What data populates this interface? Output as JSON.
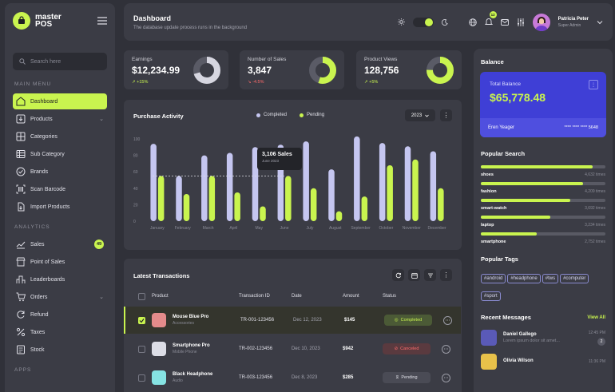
{
  "brand": {
    "line1": "master",
    "line2": "POS"
  },
  "sidebar": {
    "search_placeholder": "Search here",
    "section_main": "MAIN MENU",
    "section_analytics": "ANALYTICS",
    "section_apps": "APPS",
    "main_items": [
      {
        "label": "Dashboard",
        "icon": "home-icon",
        "active": true
      },
      {
        "label": "Products",
        "icon": "box-icon",
        "chevron": true
      },
      {
        "label": "Categories",
        "icon": "grid-icon"
      },
      {
        "label": "Sub Category",
        "icon": "table-icon"
      },
      {
        "label": "Brands",
        "icon": "check-circle-icon"
      },
      {
        "label": "Scan Barcode",
        "icon": "barcode-icon"
      },
      {
        "label": "Import Products",
        "icon": "import-icon"
      }
    ],
    "analytics_items": [
      {
        "label": "Sales",
        "icon": "trend-icon",
        "badge": "49"
      },
      {
        "label": "Point of Sales",
        "icon": "store-icon"
      },
      {
        "label": "Leaderboards",
        "icon": "leaderboard-icon"
      },
      {
        "label": "Orders",
        "icon": "cart-icon",
        "chevron": true
      },
      {
        "label": "Refund",
        "icon": "refund-icon"
      },
      {
        "label": "Taxes",
        "icon": "percent-icon"
      },
      {
        "label": "Stock",
        "icon": "stock-icon"
      }
    ]
  },
  "header": {
    "title": "Dashboard",
    "subtitle": "The database update process runs in the background",
    "notification_count": "12",
    "user_name": "Patricia Peter",
    "user_role": "Super Admin"
  },
  "stats": [
    {
      "label": "Earnings",
      "value": "$12,234.99",
      "delta": "+15%",
      "trend": "up",
      "donut_fill": 0.7
    },
    {
      "label": "Number of Sales",
      "value": "3,847",
      "delta": "-4.5%",
      "trend": "down",
      "donut_fill": 0.55
    },
    {
      "label": "Product Views",
      "value": "128,756",
      "delta": "+5%",
      "trend": "up",
      "donut_fill": 0.75
    }
  ],
  "purchase": {
    "title": "Purchase Activity",
    "legend_completed": "Completed",
    "legend_pending": "Pending",
    "year": "2023",
    "tooltip_value": "3,106 Sales",
    "tooltip_date": "June 2023"
  },
  "chart_data": {
    "type": "bar",
    "categories": [
      "January",
      "February",
      "March",
      "April",
      "May",
      "June",
      "July",
      "August",
      "September",
      "October",
      "November",
      "December"
    ],
    "ylim": [
      0,
      100
    ],
    "yticks": [
      0,
      20,
      40,
      60,
      80,
      100
    ],
    "series": [
      {
        "name": "Completed",
        "color": "#c5c6f0",
        "values": [
          94,
          55,
          80,
          83,
          90,
          93,
          97,
          63,
          103,
          95,
          91,
          85
        ]
      },
      {
        "name": "Pending",
        "color": "#c9f44f",
        "values": [
          55,
          33,
          55,
          35,
          18,
          55,
          40,
          12,
          30,
          68,
          75,
          40
        ]
      }
    ]
  },
  "transactions": {
    "title": "Latest Transactions",
    "columns": [
      "Product",
      "Transaction ID",
      "Date",
      "Amount",
      "Status"
    ],
    "rows": [
      {
        "name": "Mouse Blue Pro",
        "category": "Accessories",
        "id": "TR-001-123456",
        "date": "Dec 12, 2023",
        "amount": "$145",
        "status": "Completed",
        "status_type": "comp",
        "checked": true,
        "thumb": "#e48b8b"
      },
      {
        "name": "Smartphone Pro",
        "category": "Mobile Phone",
        "id": "TR-002-123456",
        "date": "Dec 10, 2023",
        "amount": "$942",
        "status": "Canceled",
        "status_type": "canc",
        "checked": false,
        "thumb": "#dcdde6"
      },
      {
        "name": "Black Headphone",
        "category": "Audio",
        "id": "TR-003-123456",
        "date": "Dec 8, 2023",
        "amount": "$285",
        "status": "Pending",
        "status_type": "pend",
        "checked": false,
        "thumb": "#86e3e3"
      }
    ]
  },
  "balance": {
    "title": "Balance",
    "label": "Total Balance",
    "amount": "$65,778.48",
    "holder": "Eren Yeager",
    "card_number": "**** **** **** 5648"
  },
  "popular_search": {
    "title": "Popular Search",
    "items": [
      {
        "name": "shoes",
        "count": "4,632 times",
        "fill": 0.9
      },
      {
        "name": "fashion",
        "count": "4,209 times",
        "fill": 0.82
      },
      {
        "name": "smart-watch",
        "count": "3,692 times",
        "fill": 0.72
      },
      {
        "name": "laptop",
        "count": "3,234 times",
        "fill": 0.56
      },
      {
        "name": "smartphone",
        "count": "2,752 times",
        "fill": 0.45
      }
    ]
  },
  "popular_tags": {
    "title": "Popular Tags",
    "tags": [
      "#android",
      "#headphone",
      "#tws",
      "#computer",
      "#sport"
    ]
  },
  "messages": {
    "title": "Recent Messages",
    "view_all": "View All",
    "items": [
      {
        "name": "Daniel Gallego",
        "text": "Lorem ipsum dolor sit amet...",
        "time": "12:45 PM",
        "count": "2"
      },
      {
        "name": "Olivia Wilson",
        "text": "",
        "time": "11:36 PM",
        "count": ""
      }
    ]
  }
}
